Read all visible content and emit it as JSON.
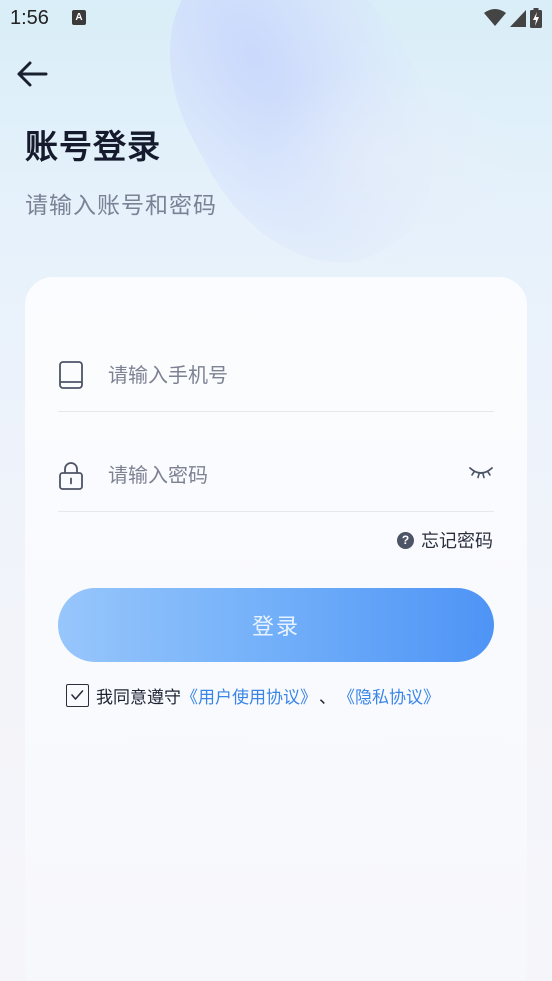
{
  "status_bar": {
    "time": "1:56",
    "notification_icon": "A"
  },
  "header": {
    "title": "账号登录",
    "subtitle": "请输入账号和密码"
  },
  "form": {
    "phone_placeholder": "请输入手机号",
    "password_placeholder": "请输入密码",
    "forgot_password": "忘记密码",
    "login_label": "登录"
  },
  "agreement": {
    "prefix": "我同意遵守",
    "user_agreement": "《用户使用协议》",
    "separator": "、",
    "privacy_agreement": "《隐私协议》",
    "checked": true
  },
  "colors": {
    "accent": "#4e94f6",
    "link": "#3a86e8",
    "button_start": "#97c6fb"
  }
}
